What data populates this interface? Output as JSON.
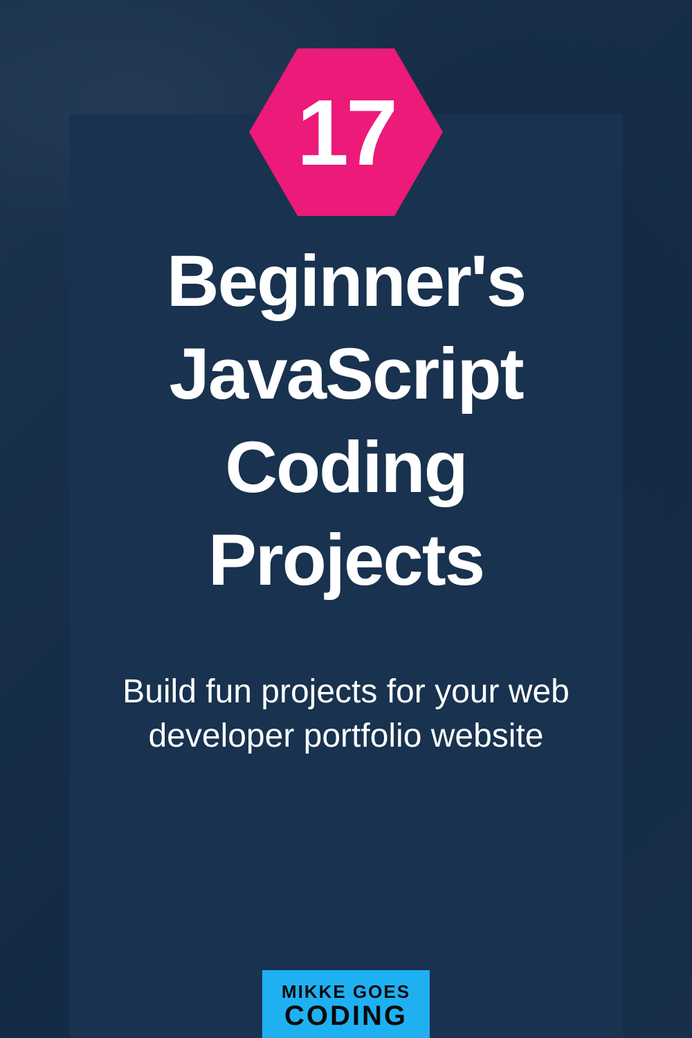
{
  "badge": {
    "number": "17"
  },
  "title": "Beginner's JavaScript Coding Projects",
  "subtitle": "Build fun projects for your web developer portfolio website",
  "logo": {
    "line1": "MIKKE GOES",
    "line2": "CODING"
  },
  "colors": {
    "accent_pink": "#ec1a78",
    "card_bg": "#18324f",
    "logo_bg": "#1fb0f2"
  }
}
